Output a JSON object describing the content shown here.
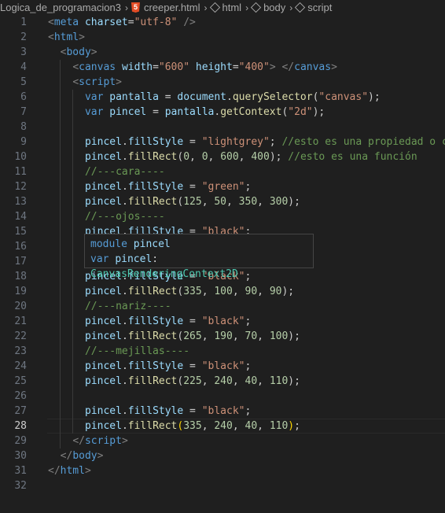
{
  "breadcrumb": {
    "folder": "Logica_de_programacion3",
    "file": "creeper.html",
    "html": "html",
    "body": "body",
    "script": "script"
  },
  "hover": {
    "line1_kw": "module",
    "line1_name": "pincel",
    "line2_kw": "var",
    "line2_name": "pincel",
    "line2_colon": ":",
    "line2_type": "CanvasRenderingContext2D"
  },
  "current_line": 28,
  "lines": [
    {
      "n": "1",
      "t": [
        [
          "t-br",
          "<"
        ],
        [
          "t-tag",
          "meta"
        ],
        [
          "t-p",
          " "
        ],
        [
          "t-attr",
          "charset"
        ],
        [
          "t-p",
          "="
        ],
        [
          "t-str",
          "\"utf-8\""
        ],
        [
          "t-p",
          " "
        ],
        [
          "t-br",
          "/>"
        ]
      ]
    },
    {
      "n": "2",
      "t": [
        [
          "t-br",
          "<"
        ],
        [
          "t-tag",
          "html"
        ],
        [
          "t-br",
          ">"
        ]
      ]
    },
    {
      "n": "3",
      "t": [
        [
          "t-p",
          "  "
        ],
        [
          "t-br",
          "<"
        ],
        [
          "t-tag",
          "body"
        ],
        [
          "t-br",
          ">"
        ]
      ]
    },
    {
      "n": "4",
      "t": [
        [
          "t-p",
          "    "
        ],
        [
          "t-br",
          "<"
        ],
        [
          "t-tag",
          "canvas"
        ],
        [
          "t-p",
          " "
        ],
        [
          "t-attr",
          "width"
        ],
        [
          "t-p",
          "="
        ],
        [
          "t-str",
          "\"600\""
        ],
        [
          "t-p",
          " "
        ],
        [
          "t-attr",
          "height"
        ],
        [
          "t-p",
          "="
        ],
        [
          "t-str",
          "\"400\""
        ],
        [
          "t-br",
          ">"
        ],
        [
          "t-p",
          " "
        ],
        [
          "t-br",
          "</"
        ],
        [
          "t-tag",
          "canvas"
        ],
        [
          "t-br",
          ">"
        ]
      ]
    },
    {
      "n": "5",
      "t": [
        [
          "t-p",
          "    "
        ],
        [
          "t-br",
          "<"
        ],
        [
          "t-tag",
          "script"
        ],
        [
          "t-br",
          ">"
        ]
      ]
    },
    {
      "n": "6",
      "t": [
        [
          "t-p",
          "      "
        ],
        [
          "t-kw",
          "var"
        ],
        [
          "t-p",
          " "
        ],
        [
          "t-var",
          "pantalla"
        ],
        [
          "t-p",
          " = "
        ],
        [
          "t-var",
          "document"
        ],
        [
          "t-p",
          "."
        ],
        [
          "t-fn",
          "querySelector"
        ],
        [
          "t-p",
          "("
        ],
        [
          "t-str",
          "\"canvas\""
        ],
        [
          "t-p",
          ");"
        ]
      ]
    },
    {
      "n": "7",
      "t": [
        [
          "t-p",
          "      "
        ],
        [
          "t-kw",
          "var"
        ],
        [
          "t-p",
          " "
        ],
        [
          "t-var",
          "pincel"
        ],
        [
          "t-p",
          " = "
        ],
        [
          "t-var",
          "pantalla"
        ],
        [
          "t-p",
          "."
        ],
        [
          "t-fn",
          "getContext"
        ],
        [
          "t-p",
          "("
        ],
        [
          "t-str",
          "\"2d\""
        ],
        [
          "t-p",
          ");"
        ]
      ]
    },
    {
      "n": "8",
      "t": []
    },
    {
      "n": "9",
      "t": [
        [
          "t-p",
          "      "
        ],
        [
          "t-var",
          "pincel"
        ],
        [
          "t-p",
          "."
        ],
        [
          "t-var",
          "fillStyle"
        ],
        [
          "t-p",
          " = "
        ],
        [
          "t-str",
          "\"lightgrey\""
        ],
        [
          "t-p",
          "; "
        ],
        [
          "t-cm",
          "//esto es una propiedad o ca"
        ]
      ]
    },
    {
      "n": "10",
      "t": [
        [
          "t-p",
          "      "
        ],
        [
          "t-var",
          "pincel"
        ],
        [
          "t-p",
          "."
        ],
        [
          "t-fn",
          "fillRect"
        ],
        [
          "t-p",
          "("
        ],
        [
          "t-num",
          "0"
        ],
        [
          "t-p",
          ", "
        ],
        [
          "t-num",
          "0"
        ],
        [
          "t-p",
          ", "
        ],
        [
          "t-num",
          "600"
        ],
        [
          "t-p",
          ", "
        ],
        [
          "t-num",
          "400"
        ],
        [
          "t-p",
          "); "
        ],
        [
          "t-cm",
          "//esto es una función"
        ]
      ]
    },
    {
      "n": "11",
      "t": [
        [
          "t-p",
          "      "
        ],
        [
          "t-cm",
          "//---cara----"
        ]
      ]
    },
    {
      "n": "12",
      "t": [
        [
          "t-p",
          "      "
        ],
        [
          "t-var",
          "pincel"
        ],
        [
          "t-p",
          "."
        ],
        [
          "t-var",
          "fillStyle"
        ],
        [
          "t-p",
          " = "
        ],
        [
          "t-str",
          "\"green\""
        ],
        [
          "t-p",
          ";"
        ]
      ]
    },
    {
      "n": "13",
      "t": [
        [
          "t-p",
          "      "
        ],
        [
          "t-var",
          "pincel"
        ],
        [
          "t-p",
          "."
        ],
        [
          "t-fn",
          "fillRect"
        ],
        [
          "t-p",
          "("
        ],
        [
          "t-num",
          "125"
        ],
        [
          "t-p",
          ", "
        ],
        [
          "t-num",
          "50"
        ],
        [
          "t-p",
          ", "
        ],
        [
          "t-num",
          "350"
        ],
        [
          "t-p",
          ", "
        ],
        [
          "t-num",
          "300"
        ],
        [
          "t-p",
          ");"
        ]
      ]
    },
    {
      "n": "14",
      "t": [
        [
          "t-p",
          "      "
        ],
        [
          "t-cm",
          "//---ojos----"
        ]
      ]
    },
    {
      "n": "15",
      "t": [
        [
          "t-p",
          "      "
        ],
        [
          "t-var",
          "pincel"
        ],
        [
          "t-p",
          "."
        ],
        [
          "t-var",
          "fillStyle"
        ],
        [
          "t-p",
          " = "
        ],
        [
          "t-str",
          "\"black\""
        ],
        [
          "t-p",
          ";"
        ]
      ]
    },
    {
      "n": "16",
      "t": []
    },
    {
      "n": "17",
      "t": []
    },
    {
      "n": "18",
      "t": [
        [
          "t-p",
          "      "
        ],
        [
          "t-var",
          "pincel"
        ],
        [
          "t-p",
          "."
        ],
        [
          "t-var",
          "fillStyle"
        ],
        [
          "t-p",
          " = "
        ],
        [
          "t-str",
          "\"black\""
        ],
        [
          "t-p",
          ";"
        ]
      ]
    },
    {
      "n": "19",
      "t": [
        [
          "t-p",
          "      "
        ],
        [
          "t-var",
          "pincel"
        ],
        [
          "t-p",
          "."
        ],
        [
          "t-fn",
          "fillRect"
        ],
        [
          "t-p",
          "("
        ],
        [
          "t-num",
          "335"
        ],
        [
          "t-p",
          ", "
        ],
        [
          "t-num",
          "100"
        ],
        [
          "t-p",
          ", "
        ],
        [
          "t-num",
          "90"
        ],
        [
          "t-p",
          ", "
        ],
        [
          "t-num",
          "90"
        ],
        [
          "t-p",
          ");"
        ]
      ]
    },
    {
      "n": "20",
      "t": [
        [
          "t-p",
          "      "
        ],
        [
          "t-cm",
          "//---nariz----"
        ]
      ]
    },
    {
      "n": "21",
      "t": [
        [
          "t-p",
          "      "
        ],
        [
          "t-var",
          "pincel"
        ],
        [
          "t-p",
          "."
        ],
        [
          "t-var",
          "fillStyle"
        ],
        [
          "t-p",
          " = "
        ],
        [
          "t-str",
          "\"black\""
        ],
        [
          "t-p",
          ";"
        ]
      ]
    },
    {
      "n": "22",
      "t": [
        [
          "t-p",
          "      "
        ],
        [
          "t-var",
          "pincel"
        ],
        [
          "t-p",
          "."
        ],
        [
          "t-fn",
          "fillRect"
        ],
        [
          "t-p",
          "("
        ],
        [
          "t-num",
          "265"
        ],
        [
          "t-p",
          ", "
        ],
        [
          "t-num",
          "190"
        ],
        [
          "t-p",
          ", "
        ],
        [
          "t-num",
          "70"
        ],
        [
          "t-p",
          ", "
        ],
        [
          "t-num",
          "100"
        ],
        [
          "t-p",
          ");"
        ]
      ]
    },
    {
      "n": "23",
      "t": [
        [
          "t-p",
          "      "
        ],
        [
          "t-cm",
          "//---mejillas----"
        ]
      ]
    },
    {
      "n": "24",
      "t": [
        [
          "t-p",
          "      "
        ],
        [
          "t-var",
          "pincel"
        ],
        [
          "t-p",
          "."
        ],
        [
          "t-var",
          "fillStyle"
        ],
        [
          "t-p",
          " = "
        ],
        [
          "t-str",
          "\"black\""
        ],
        [
          "t-p",
          ";"
        ]
      ]
    },
    {
      "n": "25",
      "t": [
        [
          "t-p",
          "      "
        ],
        [
          "t-var",
          "pincel"
        ],
        [
          "t-p",
          "."
        ],
        [
          "t-fn",
          "fillRect"
        ],
        [
          "t-p",
          "("
        ],
        [
          "t-num",
          "225"
        ],
        [
          "t-p",
          ", "
        ],
        [
          "t-num",
          "240"
        ],
        [
          "t-p",
          ", "
        ],
        [
          "t-num",
          "40"
        ],
        [
          "t-p",
          ", "
        ],
        [
          "t-num",
          "110"
        ],
        [
          "t-p",
          ");"
        ]
      ]
    },
    {
      "n": "26",
      "t": []
    },
    {
      "n": "27",
      "t": [
        [
          "t-p",
          "      "
        ],
        [
          "t-var",
          "pincel"
        ],
        [
          "t-p",
          "."
        ],
        [
          "t-var",
          "fillStyle"
        ],
        [
          "t-p",
          " = "
        ],
        [
          "t-str",
          "\"black\""
        ],
        [
          "t-p",
          ";"
        ]
      ]
    },
    {
      "n": "28",
      "t": [
        [
          "t-p",
          "      "
        ],
        [
          "t-var",
          "pincel"
        ],
        [
          "t-p",
          "."
        ],
        [
          "t-fn",
          "fillRect"
        ],
        [
          "t-paren",
          "("
        ],
        [
          "t-num",
          "335"
        ],
        [
          "t-p",
          ", "
        ],
        [
          "t-num",
          "240"
        ],
        [
          "t-p",
          ", "
        ],
        [
          "t-num",
          "40"
        ],
        [
          "t-p",
          ", "
        ],
        [
          "t-num",
          "110"
        ],
        [
          "t-paren",
          ")"
        ],
        [
          "t-p",
          ";"
        ]
      ]
    },
    {
      "n": "29",
      "t": [
        [
          "t-p",
          "    "
        ],
        [
          "t-br",
          "</"
        ],
        [
          "t-tag",
          "script"
        ],
        [
          "t-br",
          ">"
        ]
      ]
    },
    {
      "n": "30",
      "t": [
        [
          "t-p",
          "  "
        ],
        [
          "t-br",
          "</"
        ],
        [
          "t-tag",
          "body"
        ],
        [
          "t-br",
          ">"
        ]
      ]
    },
    {
      "n": "31",
      "t": [
        [
          "t-br",
          "</"
        ],
        [
          "t-tag",
          "html"
        ],
        [
          "t-br",
          ">"
        ]
      ]
    },
    {
      "n": "32",
      "t": []
    }
  ]
}
